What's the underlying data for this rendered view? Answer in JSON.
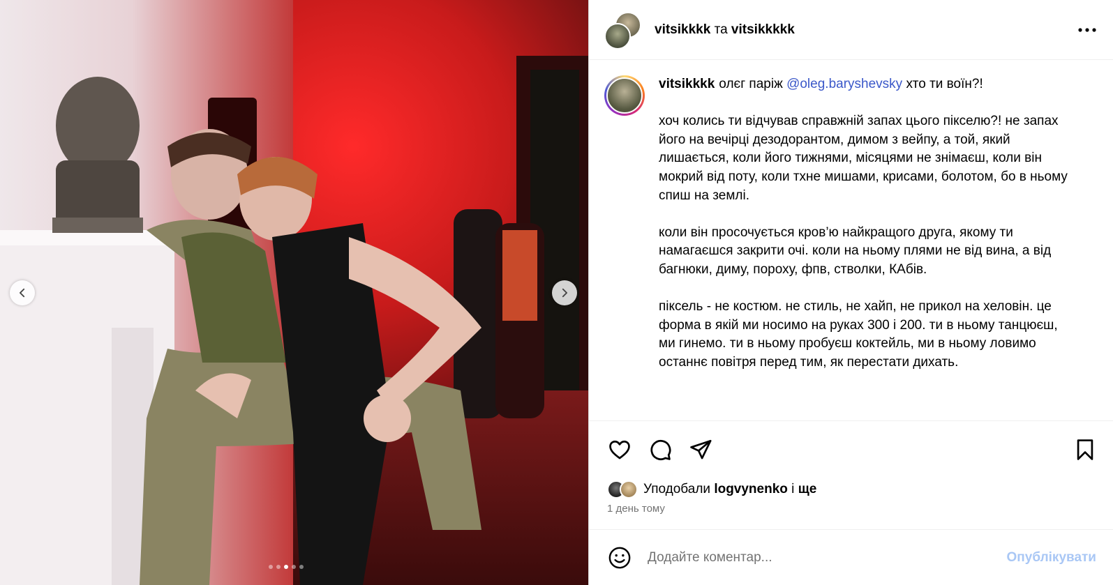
{
  "media": {
    "carousel": {
      "count": 5,
      "active_index": 2
    }
  },
  "header": {
    "user1": "vitsikkkk",
    "connector": "та",
    "user2": "vitsikkkkk"
  },
  "caption": {
    "username": "vitsikkkk",
    "first_line_before": "олєг паріж",
    "mention": "@oleg.baryshevsky",
    "first_line_after": "хто ти воїн?!",
    "paragraph1": "хоч колись ти відчував справжній запах цього пікселю?! не запах його на вечірці дезодорантом, димом з вейпу, а той, який лишається, коли його тижнями, місяцями не знімаєш, коли він мокрий від поту, коли тхне мишами, крисами, болотом, бо в ньому спиш на землі.",
    "paragraph2": "коли він просочується кров’ю найкращого друга, якому ти намагаєшся закрити очі. коли на ньому плями не від вина, а від багнюки, диму, пороху, фпв, стволки, КАбів.",
    "paragraph3": "піксель - не костюм. не стиль, не хайп, не прикол на хеловін. це форма в якій ми носимо на руках 300 і 200. ти в ньому танцюєш, ми гинемо. ти в ньому пробуєш коктейль, ми в ньому ловимо останнє повітря перед тим, як перестати дихать."
  },
  "likes": {
    "prefix": "Уподобали",
    "user": "logvynenko",
    "conj": "і",
    "more": "ще"
  },
  "time_ago": "1 день тому",
  "comment": {
    "placeholder": "Додайте коментар...",
    "publish_label": "Опублікувати"
  },
  "colors": {
    "mention": "#3b58c9",
    "publish": "#a9c7f5",
    "muted": "#737373"
  }
}
